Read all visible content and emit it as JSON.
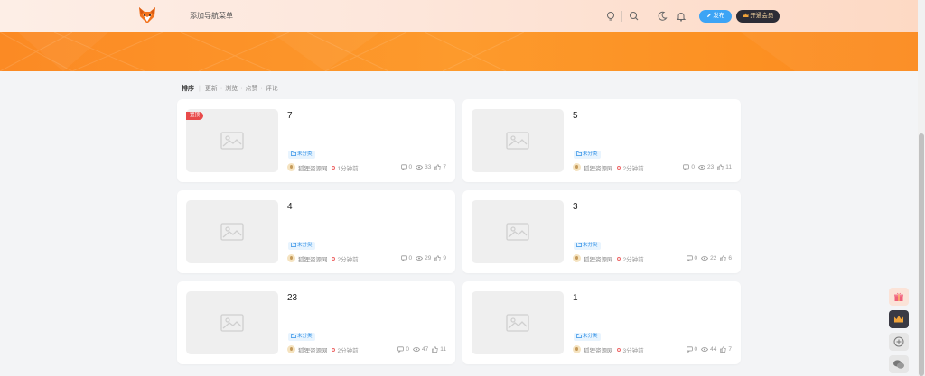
{
  "header": {
    "add_nav_menu": "添加导航菜单",
    "icons": [
      "lightbulb-icon",
      "search-icon",
      "moon-icon",
      "bell-icon"
    ],
    "publish_label": "发布",
    "vip_label": "开通会员"
  },
  "colors": {
    "banner_orange": "#fb8a24",
    "publish_blue": "#3da4f5",
    "pin_red": "#e84a4a",
    "tag_blue": "#2f8fe6",
    "vip_dark": "#2d2d36"
  },
  "sort": {
    "label": "排序",
    "options": [
      "更新",
      "浏览",
      "点赞",
      "评论"
    ]
  },
  "cards": [
    {
      "title": "7",
      "pinned_label": "置顶",
      "category": "未分类",
      "author": "狐狸资源网",
      "time": "1分钟前",
      "comments": "0",
      "views": "33",
      "likes": "7"
    },
    {
      "title": "5",
      "category": "未分类",
      "author": "狐狸资源网",
      "time": "2分钟前",
      "comments": "0",
      "views": "23",
      "likes": "11"
    },
    {
      "title": "4",
      "category": "未分类",
      "author": "狐狸资源网",
      "time": "2分钟前",
      "comments": "0",
      "views": "29",
      "likes": "9"
    },
    {
      "title": "3",
      "category": "未分类",
      "author": "狐狸资源网",
      "time": "2分钟前",
      "comments": "0",
      "views": "22",
      "likes": "6"
    },
    {
      "title": "23",
      "category": "未分类",
      "author": "狐狸资源网",
      "time": "2分钟前",
      "comments": "0",
      "views": "47",
      "likes": "11"
    },
    {
      "title": "1",
      "category": "未分类",
      "author": "狐狸资源网",
      "time": "3分钟前",
      "comments": "0",
      "views": "44",
      "likes": "7"
    }
  ],
  "floating_buttons": [
    "gift-icon",
    "crown-icon",
    "add-circle-icon",
    "wechat-icon"
  ]
}
